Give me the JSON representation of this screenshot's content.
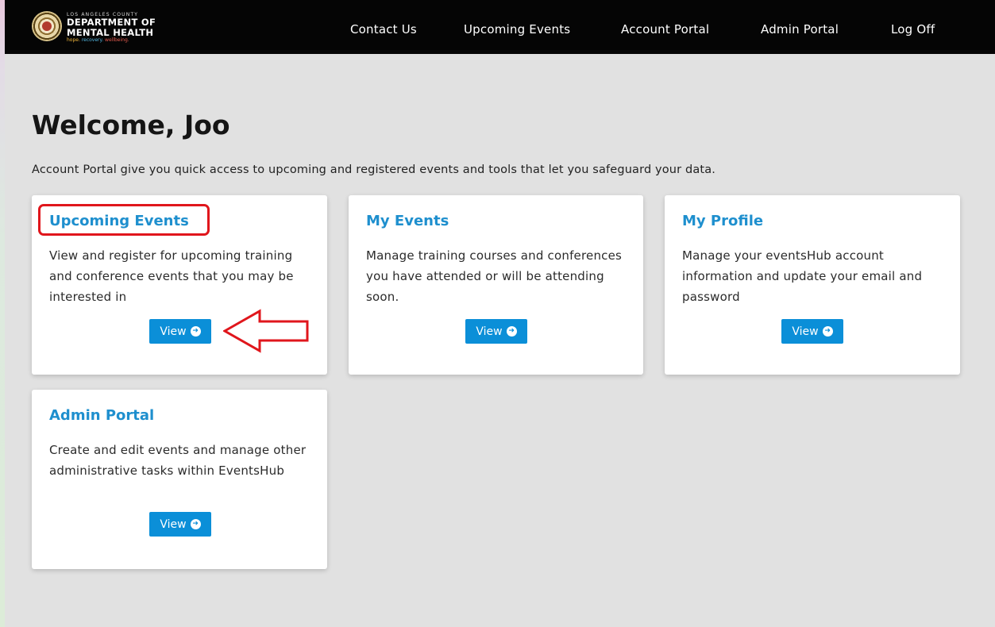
{
  "header": {
    "logo": {
      "county": "LOS ANGELES COUNTY",
      "dept_line1": "DEPARTMENT OF",
      "dept_line2": "MENTAL HEALTH",
      "tag1": "hope.",
      "tag2": "recovery.",
      "tag3": "wellbeing."
    },
    "nav": [
      {
        "label": "Contact Us"
      },
      {
        "label": "Upcoming Events"
      },
      {
        "label": "Account Portal"
      },
      {
        "label": "Admin Portal"
      },
      {
        "label": "Log Off"
      }
    ]
  },
  "main": {
    "title": "Welcome, Joo",
    "intro": "Account Portal give you quick access to upcoming and registered events and tools that let you safeguard your data.",
    "cards": [
      {
        "title": "Upcoming Events",
        "description": "View and register for upcoming training and conference events that you may be interested in",
        "button": "View"
      },
      {
        "title": "My Events",
        "description": "Manage training courses and conferences you have attended or will be attending soon.",
        "button": "View"
      },
      {
        "title": "My Profile",
        "description": "Manage your eventsHub account information and update your email and password",
        "button": "View"
      },
      {
        "title": "Admin Portal",
        "description": "Create and edit events and manage other administrative tasks within EventsHub",
        "button": "View"
      }
    ]
  },
  "colors": {
    "navbar_bg": "#050505",
    "page_bg": "#e1e1e1",
    "card_title": "#1e8fce",
    "button_bg": "#0b8fd8",
    "annotation_red": "#e0161c"
  },
  "icons": {
    "button_icon": "arrow-circle-right-icon"
  }
}
